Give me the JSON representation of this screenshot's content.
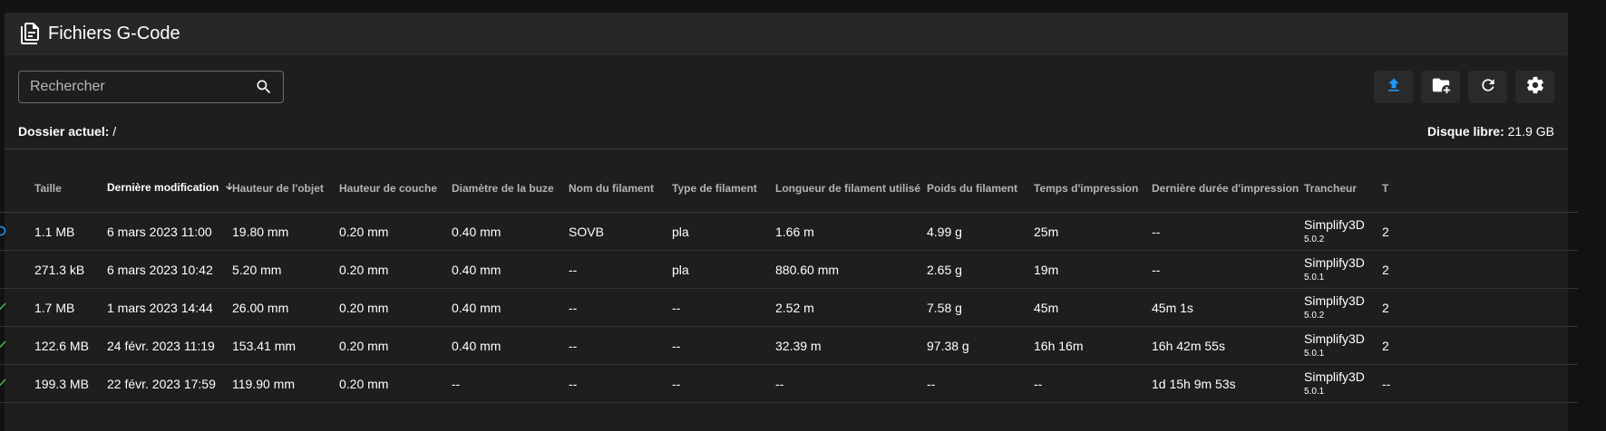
{
  "header": {
    "title": "Fichiers G-Code",
    "icon": "file-document-multiple-icon"
  },
  "search": {
    "placeholder": "Rechercher",
    "value": ""
  },
  "actions": [
    {
      "name": "upload-button",
      "icon": "upload-icon",
      "color": "#2196f3"
    },
    {
      "name": "new-folder-button",
      "icon": "folder-plus-icon",
      "color": "#ffffff"
    },
    {
      "name": "refresh-button",
      "icon": "refresh-icon",
      "color": "#ffffff"
    },
    {
      "name": "settings-button",
      "icon": "gear-icon",
      "color": "#ffffff"
    }
  ],
  "info": {
    "current_folder_label": "Dossier actuel:",
    "current_folder_value": "/",
    "free_disk_label": "Disque libre:",
    "free_disk_value": "21.9 GB"
  },
  "table": {
    "headers": [
      "Taille",
      "Dernière modification",
      "Hauteur de l'objet",
      "Hauteur de couche",
      "Diamètre de la buze",
      "Nom du filament",
      "Type de filament",
      "Longueur de filament utilisé",
      "Poids du filament",
      "Temps d'impression",
      "Dernière durée d'impression",
      "Trancheur",
      "T"
    ],
    "sorted_column": "Dernière modification",
    "sort_direction": "descending",
    "rows": [
      {
        "status": "in-progress",
        "status_color": "#2196f3",
        "size": "1.1 MB",
        "modified": "6 mars 2023 11:00",
        "object_height": "19.80 mm",
        "layer_height": "0.20 mm",
        "nozzle": "0.40 mm",
        "filament_name": "SOVB",
        "filament_type": "pla",
        "filament_length": "1.66 m",
        "filament_weight": "4.99 g",
        "print_time": "25m",
        "last_duration": "--",
        "slicer": "Simplify3D",
        "slicer_version": "5.0.2",
        "extra": "2"
      },
      {
        "status": "none",
        "status_color": "",
        "size": "271.3 kB",
        "modified": "6 mars 2023 10:42",
        "object_height": "5.20 mm",
        "layer_height": "0.20 mm",
        "nozzle": "0.40 mm",
        "filament_name": "--",
        "filament_type": "pla",
        "filament_length": "880.60 mm",
        "filament_weight": "2.65 g",
        "print_time": "19m",
        "last_duration": "--",
        "slicer": "Simplify3D",
        "slicer_version": "5.0.1",
        "extra": "2"
      },
      {
        "status": "completed",
        "status_color": "#4caf50",
        "size": "1.7 MB",
        "modified": "1 mars 2023 14:44",
        "object_height": "26.00 mm",
        "layer_height": "0.20 mm",
        "nozzle": "0.40 mm",
        "filament_name": "--",
        "filament_type": "--",
        "filament_length": "2.52 m",
        "filament_weight": "7.58 g",
        "print_time": "45m",
        "last_duration": "45m 1s",
        "slicer": "Simplify3D",
        "slicer_version": "5.0.2",
        "extra": "2"
      },
      {
        "status": "completed",
        "status_color": "#4caf50",
        "size": "122.6 MB",
        "modified": "24 févr. 2023 11:19",
        "object_height": "153.41 mm",
        "layer_height": "0.20 mm",
        "nozzle": "0.40 mm",
        "filament_name": "--",
        "filament_type": "--",
        "filament_length": "32.39 m",
        "filament_weight": "97.38 g",
        "print_time": "16h 16m",
        "last_duration": "16h 42m 55s",
        "slicer": "Simplify3D",
        "slicer_version": "5.0.1",
        "extra": "2"
      },
      {
        "status": "completed",
        "status_color": "#4caf50",
        "size": "199.3 MB",
        "modified": "22 févr. 2023 17:59",
        "object_height": "119.90 mm",
        "layer_height": "0.20 mm",
        "nozzle": "--",
        "filament_name": "--",
        "filament_type": "--",
        "filament_length": "--",
        "filament_weight": "--",
        "print_time": "--",
        "last_duration": "1d 15h 9m 53s",
        "slicer": "Simplify3D",
        "slicer_version": "5.0.1",
        "extra": "--"
      }
    ]
  }
}
